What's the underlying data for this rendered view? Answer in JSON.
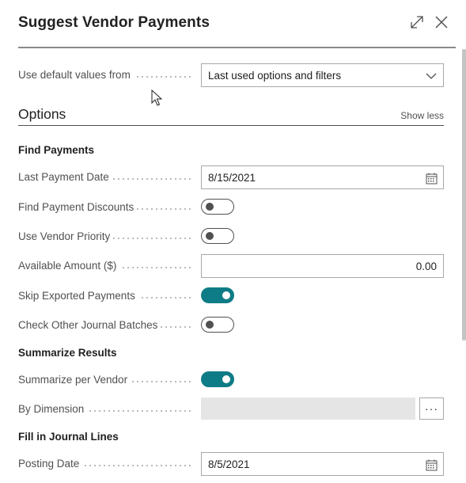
{
  "dialog": {
    "title": "Suggest Vendor Payments",
    "icons": {
      "expand": "expand-icon",
      "close": "close-icon"
    }
  },
  "defaults": {
    "label": "Use default values from",
    "value": "Last used options and filters"
  },
  "options": {
    "title": "Options",
    "toggle_label": "Show less"
  },
  "find_payments": {
    "heading": "Find Payments",
    "last_payment_date": {
      "label": "Last Payment Date",
      "value": "8/15/2021"
    },
    "find_payment_discounts": {
      "label": "Find Payment Discounts",
      "checked": false
    },
    "use_vendor_priority": {
      "label": "Use Vendor Priority",
      "checked": false
    },
    "available_amount": {
      "label": "Available Amount ($)",
      "value": "0.00"
    },
    "skip_exported_payments": {
      "label": "Skip Exported Payments",
      "checked": true
    },
    "check_other_journal_batches": {
      "label": "Check Other Journal Batches",
      "checked": false
    }
  },
  "summarize_results": {
    "heading": "Summarize Results",
    "summarize_per_vendor": {
      "label": "Summarize per Vendor",
      "checked": true
    },
    "by_dimension": {
      "label": "By Dimension",
      "value": "",
      "button": "···"
    }
  },
  "fill_journal_lines": {
    "heading": "Fill in Journal Lines",
    "posting_date": {
      "label": "Posting Date",
      "value": "8/5/2021"
    }
  },
  "colors": {
    "accent": "#0e7c86",
    "text": "#212121",
    "muted": "#505050",
    "border": "#a8a8a8"
  }
}
